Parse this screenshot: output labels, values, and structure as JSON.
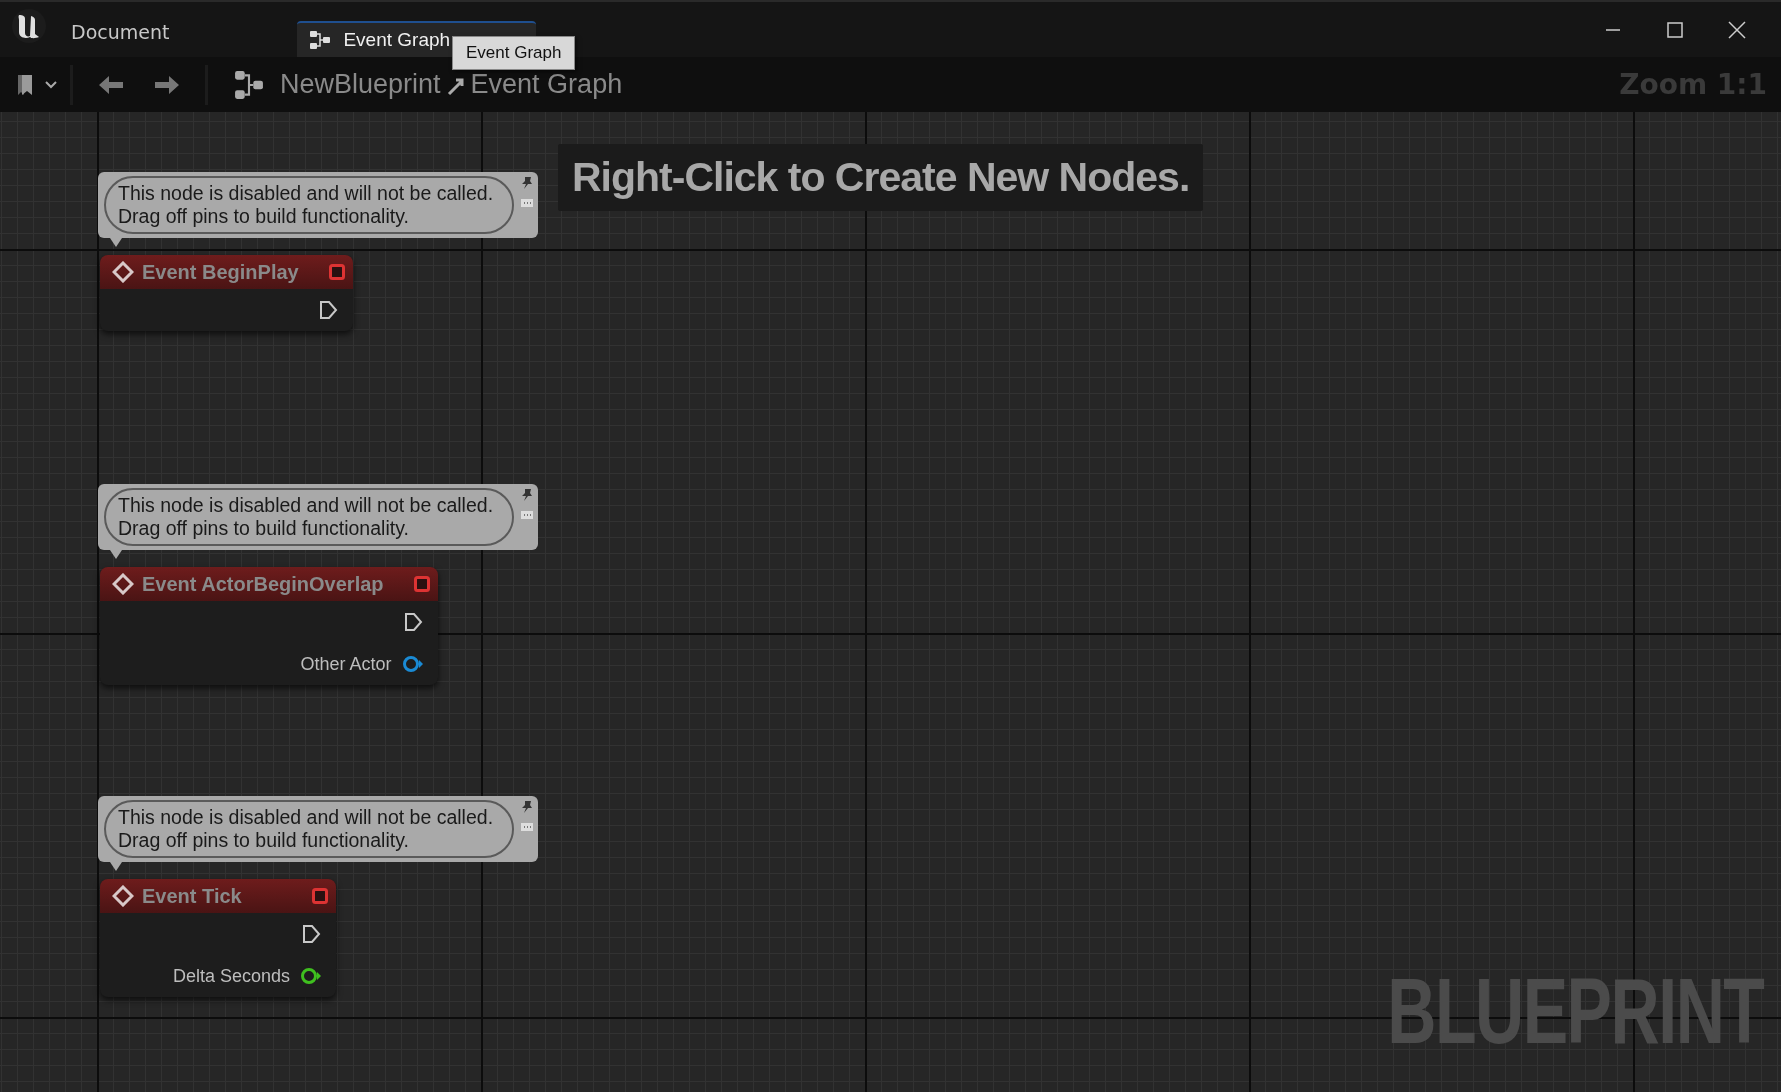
{
  "window": {
    "document_label": "Document",
    "tabs": [
      {
        "label": "Event Graph",
        "selected": true
      }
    ],
    "tooltip": "Event Graph"
  },
  "toolbar": {
    "breadcrumb": [
      "NewBlueprint",
      "Event Graph"
    ],
    "zoom": "Zoom 1:1"
  },
  "graph": {
    "hint": "Right-Click to Create New Nodes.",
    "watermark": "BLUEPRINT",
    "nodes": [
      {
        "comment": "This node is disabled and will not be called.\nDrag off pins to build functionality.",
        "title": "Event BeginPlay",
        "disabled": true,
        "pins": [
          {
            "kind": "exec"
          }
        ]
      },
      {
        "comment": "This node is disabled and will not be called.\nDrag off pins to build functionality.",
        "title": "Event ActorBeginOverlap",
        "disabled": true,
        "pins": [
          {
            "kind": "exec"
          },
          {
            "kind": "data",
            "label": "Other Actor",
            "color": "#1a8ad4"
          }
        ]
      },
      {
        "comment": "This node is disabled and will not be called.\nDrag off pins to build functionality.",
        "title": "Event Tick",
        "disabled": true,
        "pins": [
          {
            "kind": "exec"
          },
          {
            "kind": "data",
            "label": "Delta Seconds",
            "color": "#3fbf1f"
          }
        ]
      }
    ]
  }
}
